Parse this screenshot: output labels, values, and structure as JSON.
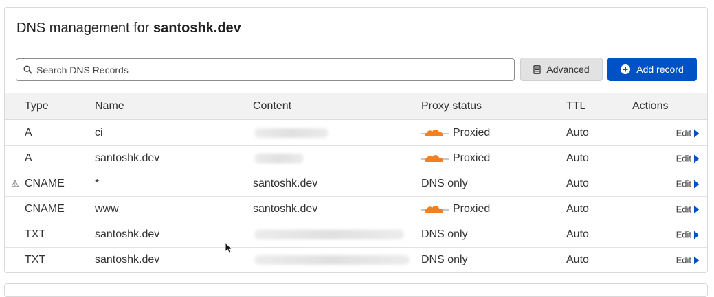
{
  "title_prefix": "DNS management for ",
  "title_domain": "santoshk.dev",
  "search": {
    "placeholder": "Search DNS Records",
    "icon": "search-icon"
  },
  "buttons": {
    "advanced": "Advanced",
    "add_record": "Add record"
  },
  "columns": {
    "type": "Type",
    "name": "Name",
    "content": "Content",
    "proxy": "Proxy status",
    "ttl": "TTL",
    "actions": "Actions"
  },
  "colors": {
    "accent": "#0051c3",
    "cloud": "#f38020"
  },
  "rows": [
    {
      "type": "A",
      "name": "ci",
      "content": "",
      "proxy": "Proxied",
      "ttl": "Auto",
      "action": "Edit",
      "warning": false
    },
    {
      "type": "A",
      "name": "santoshk.dev",
      "content": "",
      "proxy": "Proxied",
      "ttl": "Auto",
      "action": "Edit",
      "warning": false
    },
    {
      "type": "CNAME",
      "name": "*",
      "content": "santoshk.dev",
      "proxy": "DNS only",
      "ttl": "Auto",
      "action": "Edit",
      "warning": true,
      "warning_icon": "⚠"
    },
    {
      "type": "CNAME",
      "name": "www",
      "content": "santoshk.dev",
      "proxy": "Proxied",
      "ttl": "Auto",
      "action": "Edit",
      "warning": false
    },
    {
      "type": "TXT",
      "name": "santoshk.dev",
      "content": "",
      "proxy": "DNS only",
      "ttl": "Auto",
      "action": "Edit",
      "warning": false
    },
    {
      "type": "TXT",
      "name": "santoshk.dev",
      "content": "",
      "proxy": "DNS only",
      "ttl": "Auto",
      "action": "Edit",
      "warning": false
    }
  ]
}
